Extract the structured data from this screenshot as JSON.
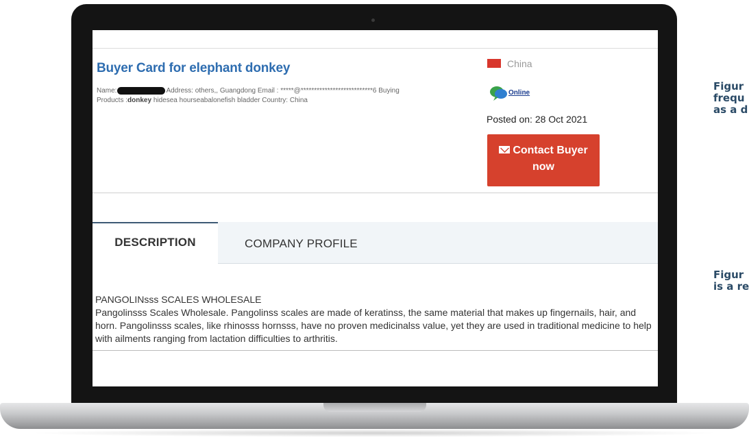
{
  "card": {
    "title": "Buyer Card for elephant donkey",
    "name_label": "Name:",
    "info_after_name": "Address: others,, Guangdong Email : *****@***************************6 Buying",
    "products_prefix": "Products :",
    "products_keyword": "donkey",
    "products_rest": " hidesea hourseabalonefish bladder Country: China",
    "country": "China",
    "online_label": "Online",
    "posted": "Posted on: 28 Oct 2021",
    "contact_line1": "Contact Buyer",
    "contact_line2": "now",
    "colors": {
      "title": "#2e6db0",
      "button": "#d6412d",
      "flag": "#d8362c"
    }
  },
  "tabs": {
    "description": "DESCRIPTION",
    "company_profile": "COMPANY PROFILE"
  },
  "description": {
    "heading": "PANGOLINsss SCALES WHOLESALE",
    "body": "Pangolinsss Scales Wholesale. Pangolinss scales are made of keratinss, the same material that makes up fingernails, hair, and horn. Pangolinsss scales, like rhinosss hornsss, have no proven medicinalss value, yet they are used in traditional medicine to help with ailments ranging from lactation difficulties to arthritis."
  },
  "side_text": {
    "block1": "Figur\nfrequ\nas a d",
    "block2": "Figur\nis a re"
  },
  "icons": {
    "flag": "china-flag-icon",
    "online": "chat-bubbles-icon",
    "mail": "envelope-icon"
  }
}
